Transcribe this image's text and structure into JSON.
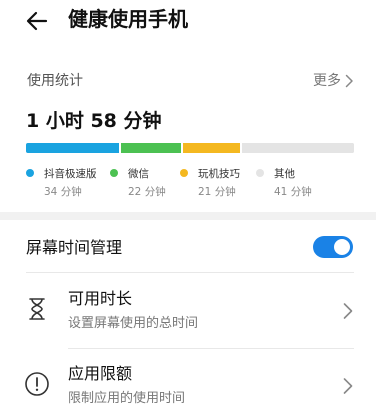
{
  "header": {
    "title": "健康使用手机",
    "back_icon": "arrow-left-icon"
  },
  "usage": {
    "section_label": "使用统计",
    "more_label": "更多",
    "total_time": "1 小时 58 分钟",
    "apps": [
      {
        "name": "抖音极速版",
        "time": "34 分钟",
        "minutes": 34,
        "color": "#1aa3e0"
      },
      {
        "name": "微信",
        "time": "22 分钟",
        "minutes": 22,
        "color": "#4cc152"
      },
      {
        "name": "玩机技巧",
        "time": "21 分钟",
        "minutes": 21,
        "color": "#f4b820"
      },
      {
        "name": "其他",
        "time": "41 分钟",
        "minutes": 41,
        "color": "#e4e4e4"
      }
    ]
  },
  "screen_time": {
    "label": "屏幕时间管理",
    "enabled": true,
    "toggle_color": "#1a82e6"
  },
  "items": [
    {
      "title": "可用时长",
      "subtitle": "设置屏幕使用的总时间",
      "icon": "hourglass-icon"
    },
    {
      "title": "应用限额",
      "subtitle": "限制应用的使用时间",
      "icon": "alert-circle-icon"
    }
  ]
}
